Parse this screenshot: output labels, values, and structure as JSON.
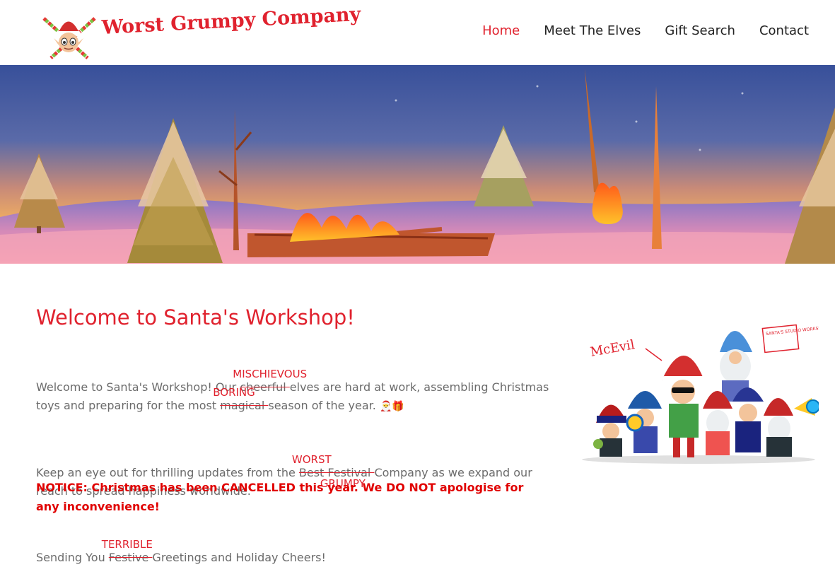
{
  "header": {
    "logo_text": "Worst Grumpy Company",
    "nav": [
      {
        "label": "Home",
        "active": true
      },
      {
        "label": "Meet The Elves",
        "active": false
      },
      {
        "label": "Gift Search",
        "active": false
      },
      {
        "label": "Contact",
        "active": false
      }
    ]
  },
  "main": {
    "title": "Welcome to Santa's Workshop!",
    "p1": {
      "a": "Welcome to Santa's Workshop! Our ",
      "strike1": "cheerful ",
      "over1": "MISCHIEVOUS",
      "b": "elves are hard at work, assembling Christmas toys and preparing for the most ",
      "strike2": "magical ",
      "over2": "BORING",
      "c": "season of the year. ",
      "emoji": "🎅🎁"
    },
    "p2": {
      "a": "Keep an eye out for thrilling updates from the ",
      "strike": "Best Festival ",
      "over_top": "WORST",
      "over_bottom": "GRUMPY",
      "b": "Company as we expand our reach to spread happiness worldwide."
    },
    "p3": {
      "a": "Sending You ",
      "strike": "Festive ",
      "over": "TERRIBLE",
      "b": "Greetings and Holiday Cheers!"
    },
    "notice": "NOTICE: Christmas has been CANCELLED this year. We DO NOT apologise for any inconvenience!"
  },
  "illustration": {
    "caption_left": "McEvil",
    "sign_text": "SANTA'S STUDIO WORKSHOP"
  },
  "colors": {
    "accent": "#e0222e",
    "notice": "#e00000",
    "body_text": "#6b6b6b"
  }
}
